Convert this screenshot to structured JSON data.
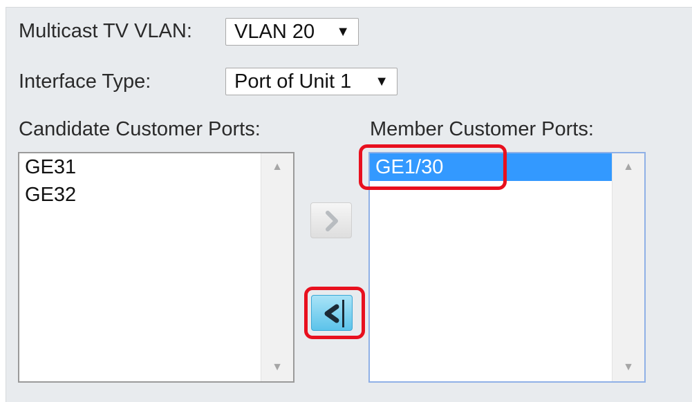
{
  "multicast_vlan": {
    "label": "Multicast TV VLAN:",
    "selected": "VLAN 20"
  },
  "interface_type": {
    "label": "Interface Type:",
    "selected": "Port of Unit 1"
  },
  "candidate_ports": {
    "label": "Candidate Customer Ports:",
    "items": [
      "GE31",
      "GE32"
    ]
  },
  "member_ports": {
    "label": "Member Customer Ports:",
    "items": [
      "GE1/30"
    ],
    "selected_item": "GE1/30"
  },
  "glyphs": {
    "caret": "▼",
    "scroll_up": "▲",
    "scroll_down": "▼"
  },
  "icons": {
    "add_button": "chevron-right-icon",
    "remove_button": "chevron-left-icon",
    "caret": "caret-down-icon"
  },
  "colors": {
    "panel_background": "#e8ebee",
    "selection": "#3399ff",
    "highlight": "#e8101e",
    "active_button": "#5cc3ea"
  }
}
